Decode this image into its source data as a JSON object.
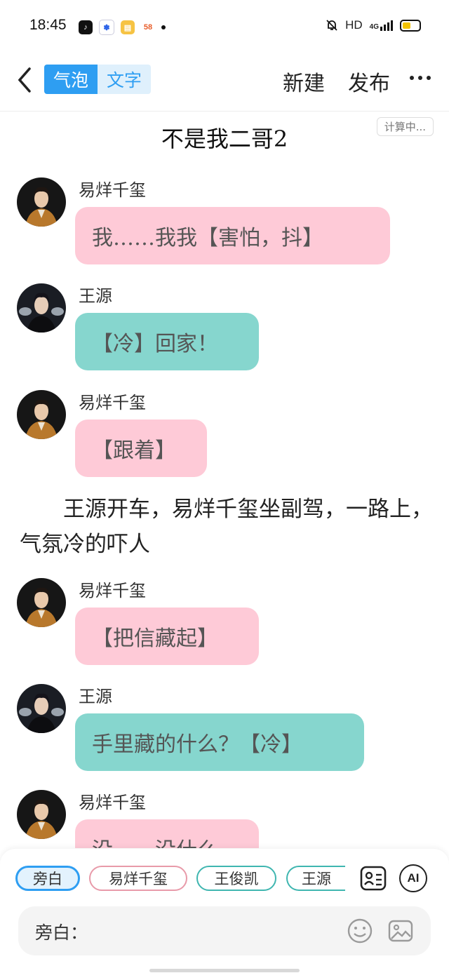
{
  "status_bar": {
    "time": "18:45",
    "network": "HD",
    "signal_label": "4G",
    "apps": [
      "tiktok-icon",
      "baidu-icon",
      "notes-icon",
      "58-icon"
    ],
    "app_58_label": "58"
  },
  "header": {
    "mode_bubble": "气泡",
    "mode_text": "文字",
    "new_label": "新建",
    "publish_label": "发布"
  },
  "story": {
    "title": "不是我二哥2",
    "word_count": "计算中...",
    "messages": [
      {
        "speaker": "易烊千玺",
        "text": "我……我我【害怕，抖】",
        "color": "pink"
      },
      {
        "speaker": "王源",
        "text": "【冷】回家！",
        "color": "teal"
      },
      {
        "speaker": "易烊千玺",
        "text": "【跟着】",
        "color": "pink"
      },
      {
        "speaker": "易烊千玺",
        "text": "【把信藏起】",
        "color": "pink"
      },
      {
        "speaker": "王源",
        "text": "手里藏的什么？【冷】",
        "color": "teal"
      },
      {
        "speaker": "易烊千玺",
        "text": "没……没什么",
        "color": "pink"
      }
    ],
    "narration": "王源开车，易烊千玺坐副驾，一路上，气氛冷的吓人"
  },
  "composer": {
    "roles": [
      "旁白",
      "易烊千玺",
      "王俊凯",
      "王源"
    ],
    "input_label": "旁白：",
    "ai_label": "AI"
  },
  "colors": {
    "accent": "#2e9ef2",
    "pink_bubble": "#fecad7",
    "teal_bubble": "#86d6ce"
  }
}
